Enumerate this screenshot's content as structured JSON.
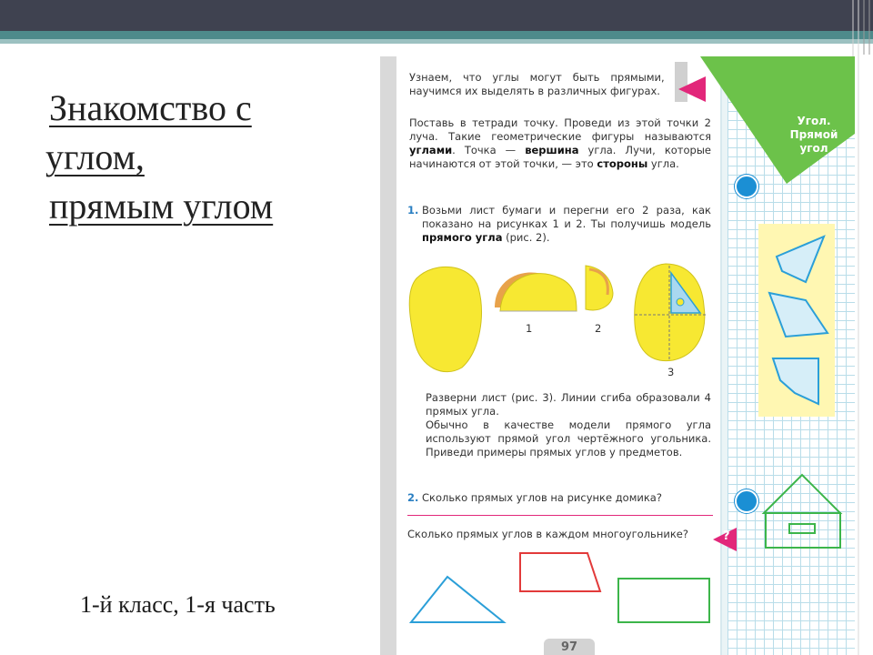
{
  "slide": {
    "title_line1": "Знакомство с",
    "title_line2": "углом,",
    "title_line3": "прямым углом",
    "subtitle": "1-й класс, 1-я часть"
  },
  "textbook": {
    "corner_tag_line1": "Угол.",
    "corner_tag_line2": "Прямой угол",
    "intro": "Узнаем, что углы могут быть прямыми, и научимся их выделять в различных фигурах.",
    "definition_a": "Поставь в тетради точку. Проведи из этой точки 2 луча. Такие геометрические фигуры называются ",
    "definition_angles": "углами",
    "definition_b": ". Точка — ",
    "definition_vertex": "вершина",
    "definition_c": " угла. Лучи, которые начинаются от этой точки, — это ",
    "definition_sides": "стороны",
    "definition_d": " угла.",
    "task1_num": "1.",
    "task1_a": "Возьми лист бумаги и перегни его 2 раза, как показано на рисунках 1 и 2. Ты получишь модель ",
    "task1_bold": "прямого угла",
    "task1_b": " (рис. 2).",
    "fig1": "1",
    "fig2": "2",
    "fig3": "3",
    "unfold": "Разверни лист (рис. 3). Линии сгиба образовали 4 прямых угла.",
    "model": "Обычно в качестве модели прямого угла используют прямой угол чертёжного угольника. Приведи примеры прямых углов у предметов.",
    "task2_num": "2.",
    "task2": "Сколько прямых углов на рисунке домика?",
    "question": "Сколько прямых углов в каждом многоугольнике?",
    "question_mark": "?",
    "page_number": "97"
  },
  "colors": {
    "top_bar": "#3f4250",
    "teal": "#4e8a8b",
    "green_tag": "#6cc24a",
    "pink": "#e2277a",
    "paper_yellow": "#f7e832",
    "figure_blue": "#2b9fd8",
    "figure_red": "#e23a3a",
    "figure_green": "#3cb54a"
  }
}
